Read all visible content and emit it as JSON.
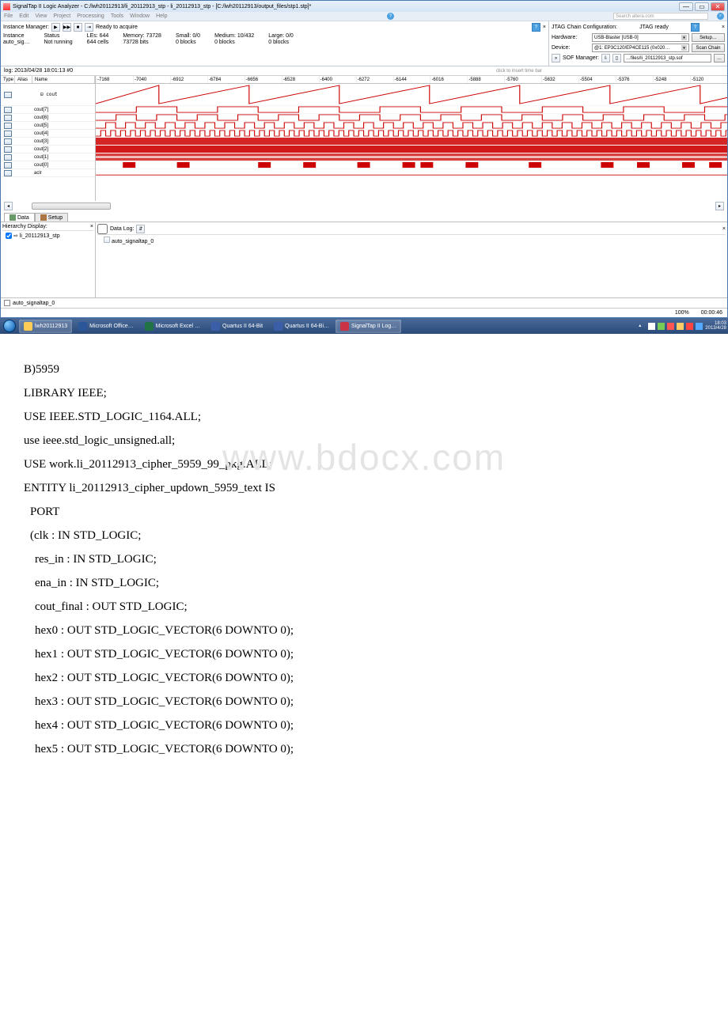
{
  "title_bar": "SignalTap II Logic Analyzer - C:/lwh20112913/li_20112913_stp - li_20112913_stp - [C:/lwh20112913/output_files/stp1.stp]*",
  "menu": [
    "File",
    "Edit",
    "View",
    "Project",
    "Processing",
    "Tools",
    "Window",
    "Help"
  ],
  "search_placeholder": "Search altera.com",
  "instance_manager": {
    "label": "Instance Manager:",
    "ready": "Ready to acquire",
    "cols": [
      "Instance",
      "Status",
      "LEs: 644",
      "Memory: 73728",
      "Small: 0/0",
      "Medium: 10/432",
      "Large: 0/0"
    ],
    "row": [
      "auto_sig…",
      "Not running",
      "644 cells",
      "73728 bits",
      "0 blocks",
      "0 blocks",
      "0 blocks"
    ]
  },
  "jtag": {
    "header": "JTAG Chain Configuration:",
    "status": "JTAG ready",
    "hardware_label": "Hardware:",
    "hardware_value": "USB-Blaster [USB-0]",
    "setup_btn": "Setup…",
    "device_label": "Device:",
    "device_value": "@1: EP3C120/EP4CE115 (0x020…",
    "scan_btn": "Scan Chain",
    "sof_label": "SOF Manager:",
    "sof_value": "…files/li_20112913_stp.sof"
  },
  "log_label": "log: 2013/04/28 18:01:13  #0",
  "insert_hint": "click to insert time bar",
  "signal_headers": {
    "type": "Type",
    "alias": "Alias",
    "name": "Name"
  },
  "signals": {
    "group": "⊟ cout",
    "bits": [
      "cout[7]",
      "cout[6]",
      "cout[5]",
      "cout[4]",
      "cout[3]",
      "cout[2]",
      "cout[1]",
      "cout[0]"
    ],
    "last": "aclr"
  },
  "ruler": [
    "-7168",
    "-7040",
    "-6912",
    "-6784",
    "-6656",
    "-6528",
    "-6400",
    "-6272",
    "-6144",
    "-6016",
    "-5888",
    "-5760",
    "-5632",
    "-5504",
    "-5376",
    "-5248",
    "-5120"
  ],
  "tabs": {
    "data": "Data",
    "setup": "Setup"
  },
  "hierarchy": {
    "title": "Hierarchy Display:",
    "item": "li_20112913_stp"
  },
  "data_log": {
    "title": "Data Log:",
    "item": "auto_signaltap_0"
  },
  "bottom_tab": "auto_signaltap_0",
  "status": {
    "zoom": "100%",
    "time": "00:00:46"
  },
  "taskbar": {
    "items": [
      "lwh20112913",
      "Microsoft Office…",
      "Microsoft Excel …",
      "Quartus II 64-Bit",
      "Quartus II 64-Bi…",
      "SignalTap II Log…"
    ],
    "clock_time": "18:03",
    "clock_date": "2013/4/28"
  },
  "watermark": "www.bdocx.com",
  "code": [
    "B)5959",
    "LIBRARY IEEE;",
    "USE IEEE.STD_LOGIC_1164.ALL;",
    "use ieee.std_logic_unsigned.all;",
    "USE work.li_20112913_cipher_5959_99_pkg.ALL;",
    "ENTITY li_20112913_cipher_updown_5959_text IS",
    " PORT",
    " (clk : IN STD_LOGIC;",
    "  res_in : IN STD_LOGIC;",
    "  ena_in : IN STD_LOGIC;",
    "  cout_final : OUT STD_LOGIC;",
    "  hex0 : OUT STD_LOGIC_VECTOR(6 DOWNTO 0);",
    "  hex1 : OUT STD_LOGIC_VECTOR(6 DOWNTO 0);",
    "  hex2 : OUT STD_LOGIC_VECTOR(6 DOWNTO 0);",
    "  hex3 : OUT STD_LOGIC_VECTOR(6 DOWNTO 0);",
    "  hex4 : OUT STD_LOGIC_VECTOR(6 DOWNTO 0);",
    "  hex5 : OUT STD_LOGIC_VECTOR(6 DOWNTO 0);"
  ]
}
